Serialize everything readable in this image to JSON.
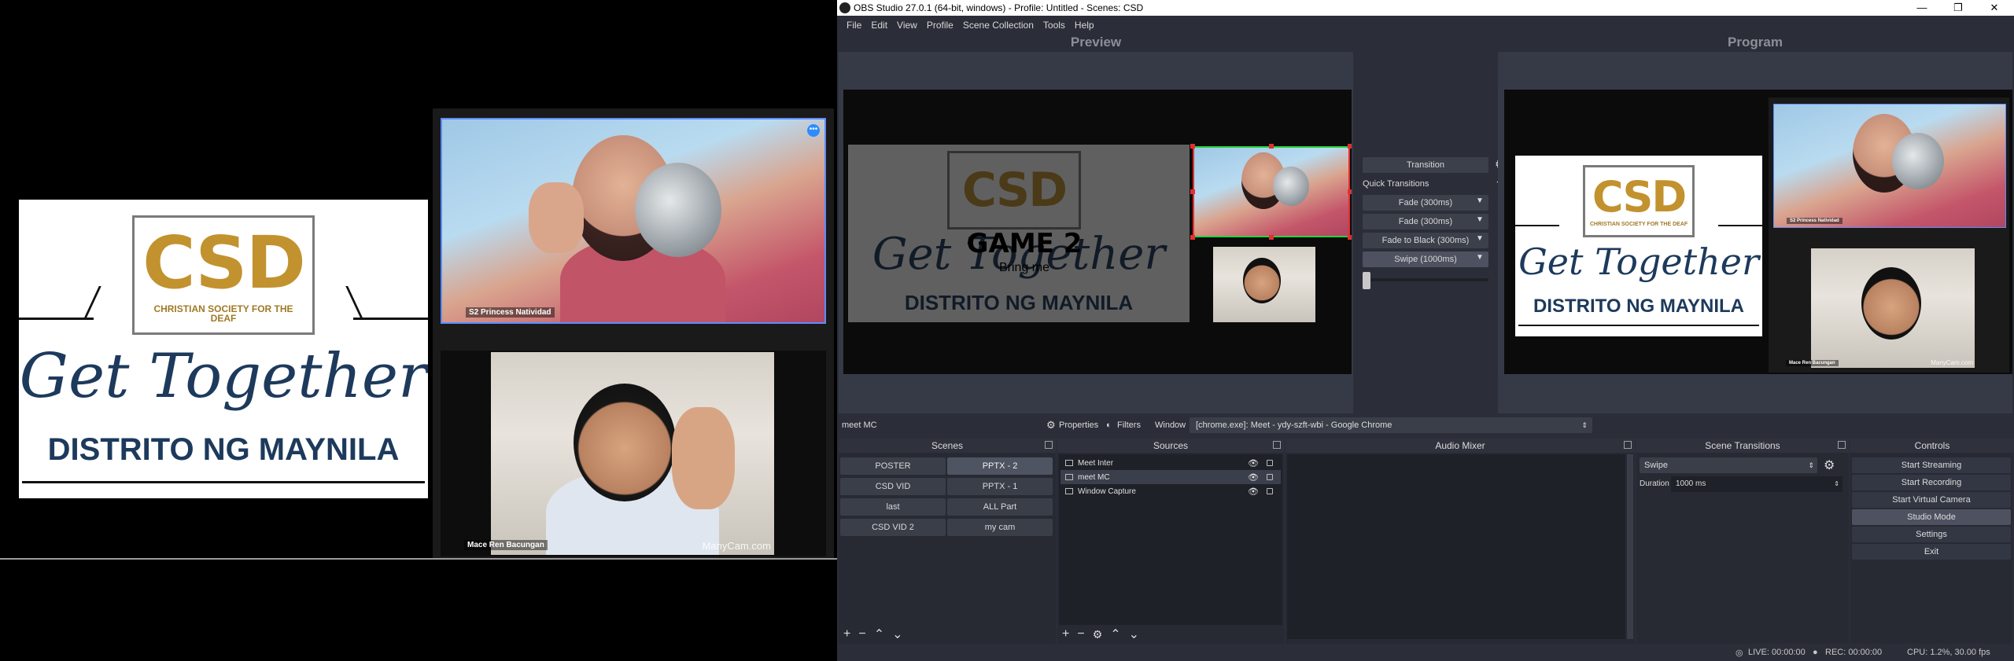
{
  "left_output": {
    "logo": {
      "csd_text": "CSD",
      "csd_subtitle": "CHRISTIAN SOCIETY FOR THE DEAF",
      "headline": "Get Together",
      "district": "DISTRITO NG MAYNILA"
    },
    "participants": [
      {
        "name": "S2 Princess Natividad"
      },
      {
        "name": "Mace Ren Bacungan",
        "watermark": "ManyCam.com"
      }
    ]
  },
  "obs": {
    "title": "OBS Studio 27.0.1 (64-bit, windows) - Profile: Untitled - Scenes: CSD",
    "window_controls": {
      "minimize": "—",
      "restore": "❐",
      "close": "✕"
    },
    "menu": [
      "File",
      "Edit",
      "View",
      "Profile",
      "Scene Collection",
      "Tools",
      "Help"
    ],
    "preview_label": "Preview",
    "program_label": "Program",
    "preview_overlay": {
      "title": "GAME 2",
      "subtitle": "Bring me"
    },
    "transition_panel": {
      "transition_button": "Transition",
      "quick_transitions_label": "Quick Transitions",
      "items": [
        "Fade (300ms)",
        "Fade (300ms)",
        "Fade to Black (300ms)",
        "Swipe (1000ms)"
      ]
    },
    "source_toolbar": {
      "selected_source": "meet MC",
      "properties": "Properties",
      "filters": "Filters",
      "window_label": "Window",
      "window_value": "[chrome.exe]: Meet - ydy-szft-wbi - Google Chrome"
    },
    "docks": {
      "scenes": {
        "title": "Scenes",
        "buttons": [
          "POSTER",
          "PPTX - 2",
          "CSD VID",
          "PPTX - 1",
          "last",
          "ALL Part",
          "CSD VID 2",
          "my cam"
        ]
      },
      "sources": {
        "title": "Sources",
        "items": [
          "Meet Inter",
          "meet MC",
          "Window Capture"
        ]
      },
      "audio_mixer": {
        "title": "Audio Mixer"
      },
      "scene_transitions": {
        "title": "Scene Transitions",
        "selected": "Swipe",
        "duration_label": "Duration",
        "duration_value": "1000 ms"
      },
      "controls": {
        "title": "Controls",
        "buttons": [
          "Start Streaming",
          "Start Recording",
          "Start Virtual Camera",
          "Studio Mode",
          "Settings",
          "Exit"
        ]
      }
    },
    "status": {
      "live": "LIVE: 00:00:00",
      "rec": "REC: 00:00:00",
      "cpu": "CPU: 1.2%, 30.00 fps"
    }
  },
  "colors": {
    "obs_background": "#2b2e38",
    "selection_red": "#e23030",
    "selection_green": "#28d23c",
    "logo_gold": "#c2922f",
    "logo_navy": "#1d3a5c",
    "zoom_active_blue": "#2d8cff"
  }
}
